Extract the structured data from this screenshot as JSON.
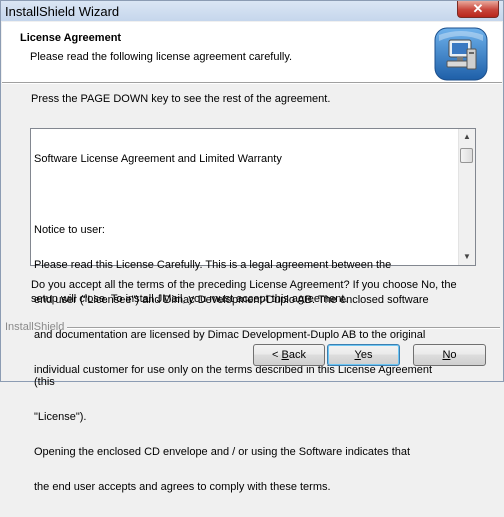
{
  "window": {
    "title": "InstallShield Wizard",
    "close_label": "✕"
  },
  "header": {
    "title": "License Agreement",
    "subtitle": "Please read the following license agreement carefully."
  },
  "instructions": "Press the PAGE DOWN key to see the rest of the agreement.",
  "license": {
    "lines": [
      "Software License Agreement and Limited Warranty",
      "",
      "Notice to user:",
      "Please read this License Carefully. This is a legal agreement between the",
      "end user (\"Licensee\") and Dimac Development-Duplo AB. The enclosed software",
      "and documentation are licensed by Dimac Development-Duplo AB to the original",
      "individual customer for use only on the terms described in this License Agreement (this",
      "\"License\").",
      "Opening the enclosed CD envelope and / or using the Software indicates that",
      "the end user accepts and agrees to comply with these terms."
    ]
  },
  "question": "Do you accept all the terms of the preceding License Agreement?  If you choose No,  the setup will close.  To install JMail, you must accept this agreement.",
  "footer": {
    "brand": "InstallShield"
  },
  "buttons": {
    "back": {
      "prefix": "< ",
      "hotkey": "B",
      "rest": "ack"
    },
    "yes": {
      "hotkey": "Y",
      "rest": "es"
    },
    "no": {
      "hotkey": "N",
      "rest": "o"
    }
  },
  "colors": {
    "title_bar": "#c5d6ec",
    "close_button": "#c8453a",
    "default_button_border": "#3c7fb1"
  }
}
